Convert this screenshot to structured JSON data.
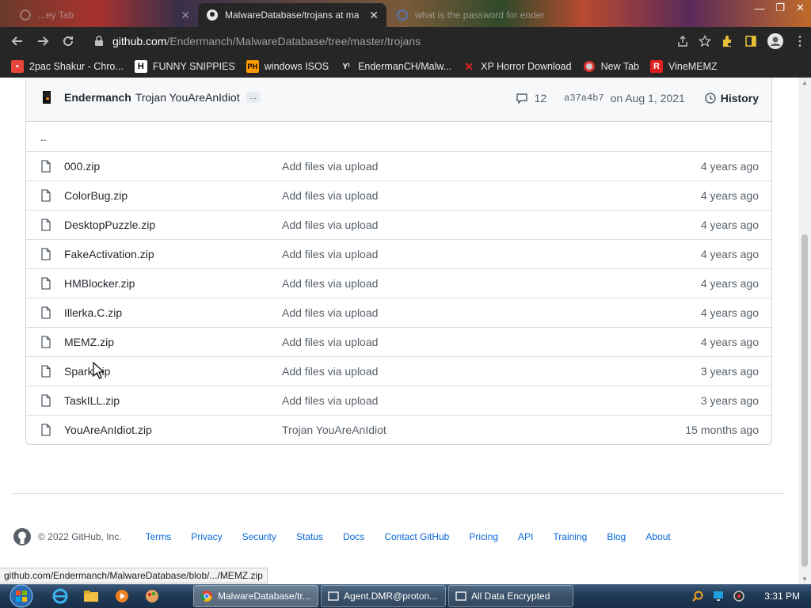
{
  "browser": {
    "tabs": [
      {
        "title": "...ey Tab",
        "state": "inactive"
      },
      {
        "title": "MalwareDatabase/trojans at ma",
        "state": "active"
      },
      {
        "title": "what is the password for ender",
        "state": "inactive"
      }
    ],
    "url": {
      "host": "github.com",
      "path": "/Endermanch/MalwareDatabase/tree/master/trojans"
    },
    "bookmarks": [
      {
        "label": "2pac Shakur - Chro...",
        "icon": "calendar-icon",
        "color": "#e8453c"
      },
      {
        "label": "FUNNY SNIPPIES",
        "icon": "h-icon",
        "color": "#ffffff"
      },
      {
        "label": "windows ISOS",
        "icon": "ph-icon",
        "color": "#ff9900"
      },
      {
        "label": "EndermanCH/Malw...",
        "icon": "yp-icon",
        "color": "#ffffff"
      },
      {
        "label": "XP Horror Download",
        "icon": "x-icon",
        "color": "#e02020"
      },
      {
        "label": "New Tab",
        "icon": "globe-icon",
        "color": "#cccccc"
      },
      {
        "label": "VineMEMZ",
        "icon": "r-icon",
        "color": "#e02020"
      }
    ]
  },
  "commit": {
    "author": "Endermanch",
    "message": "Trojan YouAreAnIdiot",
    "ellipsis": "...",
    "comments": "12",
    "sha": "a37a4b7",
    "date": "on Aug 1, 2021",
    "history_label": "History"
  },
  "parent_dir": "..",
  "files": [
    {
      "name": "000.zip",
      "message": "Add files via upload",
      "age": "4 years ago"
    },
    {
      "name": "ColorBug.zip",
      "message": "Add files via upload",
      "age": "4 years ago"
    },
    {
      "name": "DesktopPuzzle.zip",
      "message": "Add files via upload",
      "age": "4 years ago"
    },
    {
      "name": "FakeActivation.zip",
      "message": "Add files via upload",
      "age": "4 years ago"
    },
    {
      "name": "HMBlocker.zip",
      "message": "Add files via upload",
      "age": "4 years ago"
    },
    {
      "name": "Illerka.C.zip",
      "message": "Add files via upload",
      "age": "4 years ago"
    },
    {
      "name": "MEMZ.zip",
      "message": "Add files via upload",
      "age": "4 years ago"
    },
    {
      "name": "Spark.zip",
      "message": "Add files via upload",
      "age": "3 years ago"
    },
    {
      "name": "TaskILL.zip",
      "message": "Add files via upload",
      "age": "3 years ago"
    },
    {
      "name": "YouAreAnIdiot.zip",
      "message": "Trojan YouAreAnIdiot",
      "age": "15 months ago"
    }
  ],
  "footer": {
    "copyright": "© 2022 GitHub, Inc.",
    "links": [
      "Terms",
      "Privacy",
      "Security",
      "Status",
      "Docs",
      "Contact GitHub",
      "Pricing",
      "API",
      "Training",
      "Blog",
      "About"
    ]
  },
  "status_url": "github.com/Endermanch/MalwareDatabase/blob/.../MEMZ.zip",
  "taskbar": {
    "tasks": [
      {
        "label": "MalwareDatabase/tr...",
        "active": true
      },
      {
        "label": "Agent.DMR@proton...",
        "active": false
      },
      {
        "label": "All Data Encrypted",
        "active": false
      }
    ],
    "clock": "3:31 PM"
  },
  "colors": {
    "link": "#0969da",
    "text": "#24292f",
    "muted": "#57606a",
    "border": "#d0d7de"
  }
}
